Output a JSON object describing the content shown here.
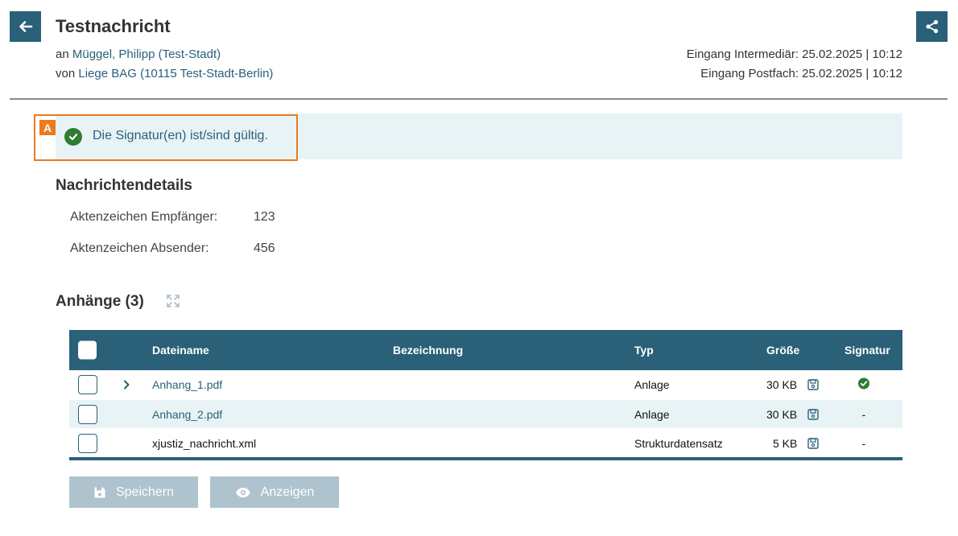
{
  "header": {
    "title": "Testnachricht",
    "to_prefix": "an",
    "to_name": "Müggel, Philipp (Test-Stadt)",
    "from_prefix": "von",
    "from_name": "Liege BAG (10115 Test-Stadt-Berlin)",
    "received_intermediary": "Eingang Intermediär: 25.02.2025 | 10:12",
    "received_mailbox": "Eingang Postfach: 25.02.2025 | 10:12",
    "back_icon": "arrow-left-icon",
    "share_icon": "share-icon"
  },
  "signature_banner": {
    "marker": "A",
    "text": "Die Signatur(en) ist/sind gültig.",
    "icon": "check-circle-icon",
    "highlight_color": "#ec7a1f"
  },
  "details": {
    "title": "Nachrichtendetails",
    "rows": [
      {
        "label": "Aktenzeichen Empfänger:",
        "value": "123"
      },
      {
        "label": "Aktenzeichen Absender:",
        "value": "456"
      }
    ]
  },
  "attachments": {
    "title": "Anhänge (3)",
    "columns": {
      "name": "Dateiname",
      "description": "Bezeichnung",
      "type": "Typ",
      "size": "Größe",
      "signature": "Signatur"
    },
    "rows": [
      {
        "name": "Anhang_1.pdf",
        "description": "",
        "type": "Anlage",
        "size": "30 KB",
        "signature": "valid",
        "expandable": true,
        "link": true
      },
      {
        "name": "Anhang_2.pdf",
        "description": "",
        "type": "Anlage",
        "size": "30 KB",
        "signature": "-",
        "expandable": false,
        "link": true
      },
      {
        "name": "xjustiz_nachricht.xml",
        "description": "",
        "type": "Strukturdatensatz",
        "size": "5 KB",
        "signature": "-",
        "expandable": false,
        "link": false
      }
    ]
  },
  "actions": {
    "save_label": "Speichern",
    "view_label": "Anzeigen",
    "save_icon": "floppy-disk-icon",
    "view_icon": "eye-icon"
  },
  "colors": {
    "primary": "#2a6078",
    "banner_bg": "#e8f3f5",
    "valid_green": "#2e7d32",
    "disabled_button": "#aec3cd"
  }
}
